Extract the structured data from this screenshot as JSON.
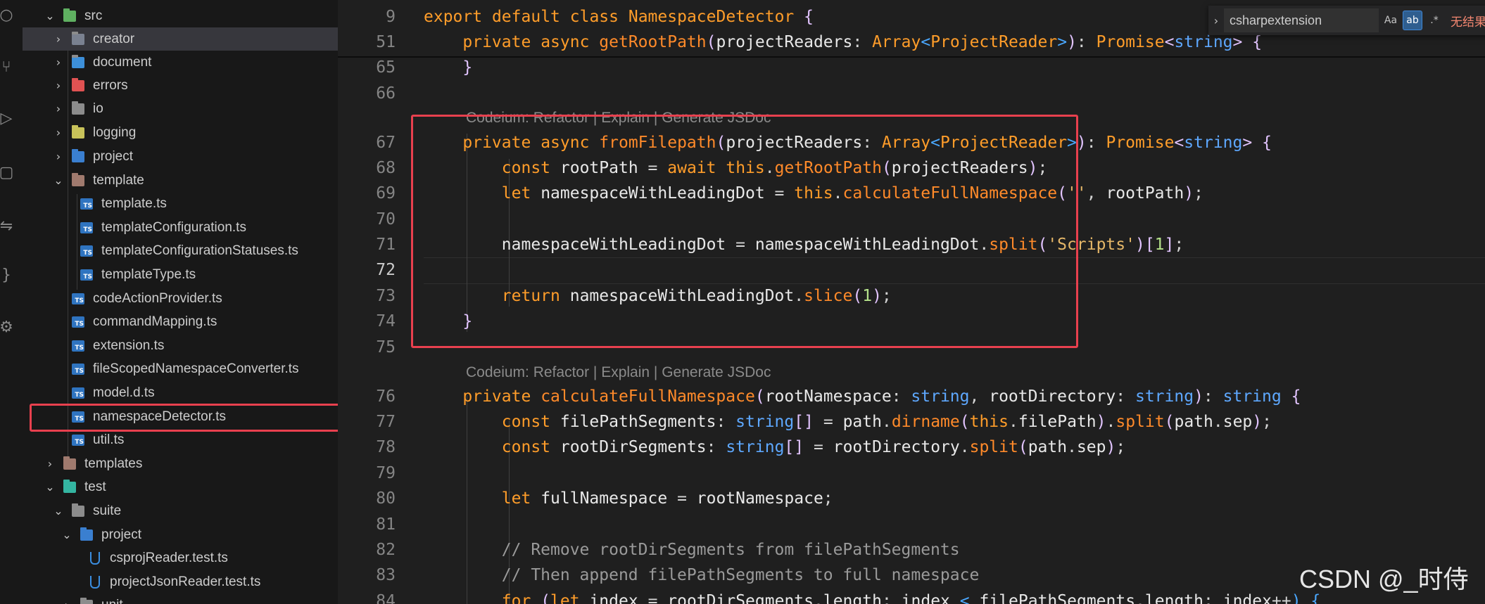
{
  "explorer": {
    "items": [
      {
        "label": "src",
        "expanded": true,
        "icon": "folder-src"
      },
      {
        "label": "creator",
        "expanded": false,
        "icon": "folder"
      },
      {
        "label": "document",
        "expanded": false,
        "icon": "folder-document"
      },
      {
        "label": "errors",
        "expanded": false,
        "icon": "folder-errors"
      },
      {
        "label": "io",
        "expanded": false,
        "icon": "folder"
      },
      {
        "label": "logging",
        "expanded": false,
        "icon": "folder-logging"
      },
      {
        "label": "project",
        "expanded": false,
        "icon": "folder-project"
      },
      {
        "label": "template",
        "expanded": true,
        "icon": "folder-template"
      },
      {
        "label": "template.ts",
        "icon": "typescript-file"
      },
      {
        "label": "templateConfiguration.ts",
        "icon": "typescript-file"
      },
      {
        "label": "templateConfigurationStatuses.ts",
        "icon": "typescript-file"
      },
      {
        "label": "templateType.ts",
        "icon": "typescript-file"
      },
      {
        "label": "codeActionProvider.ts",
        "icon": "typescript-file"
      },
      {
        "label": "commandMapping.ts",
        "icon": "typescript-file"
      },
      {
        "label": "extension.ts",
        "icon": "typescript-file"
      },
      {
        "label": "fileScopedNamespaceConverter.ts",
        "icon": "typescript-file"
      },
      {
        "label": "model.d.ts",
        "icon": "typescript-file"
      },
      {
        "label": "namespaceDetector.ts",
        "icon": "typescript-file"
      },
      {
        "label": "util.ts",
        "icon": "typescript-file"
      },
      {
        "label": "templates",
        "expanded": false,
        "icon": "folder-template"
      },
      {
        "label": "test",
        "expanded": true,
        "icon": "folder-test"
      },
      {
        "label": "suite",
        "expanded": true,
        "icon": "folder"
      },
      {
        "label": "project",
        "expanded": true,
        "icon": "folder-project"
      },
      {
        "label": "csprojReader.test.ts",
        "icon": "test-file"
      },
      {
        "label": "projectJsonReader.test.ts",
        "icon": "test-file"
      },
      {
        "label": "unit",
        "expanded": false,
        "icon": "folder"
      }
    ]
  },
  "find_widget": {
    "query": "csharpextension",
    "match_case": "Aa",
    "whole_word": "ab",
    "regex": ".*",
    "results": "无结果"
  },
  "editor": {
    "codelens_1": "Codeium: Refactor | Explain | Generate JSDoc",
    "codelens_2": "Codeium: Refactor | Explain | Generate JSDoc",
    "lines": [
      {
        "num": "9",
        "code": "export default class NamespaceDetector {"
      },
      {
        "num": "51",
        "code": "    private async getRootPath(projectReaders: Array<ProjectReader>): Promise<string> {"
      },
      {
        "num": "65",
        "code": "    }"
      },
      {
        "num": "66",
        "code": ""
      },
      {
        "num": "67",
        "code": "    private async fromFilepath(projectReaders: Array<ProjectReader>): Promise<string> {"
      },
      {
        "num": "68",
        "code": "        const rootPath = await this.getRootPath(projectReaders);"
      },
      {
        "num": "69",
        "code": "        let namespaceWithLeadingDot = this.calculateFullNamespace('', rootPath);"
      },
      {
        "num": "70",
        "code": ""
      },
      {
        "num": "71",
        "code": "        namespaceWithLeadingDot = namespaceWithLeadingDot.split('Scripts')[1];"
      },
      {
        "num": "72",
        "code": ""
      },
      {
        "num": "73",
        "code": "        return namespaceWithLeadingDot.slice(1);"
      },
      {
        "num": "74",
        "code": "    }"
      },
      {
        "num": "75",
        "code": ""
      },
      {
        "num": "76",
        "code": "    private calculateFullNamespace(rootNamespace: string, rootDirectory: string): string {"
      },
      {
        "num": "77",
        "code": "        const filePathSegments: string[] = path.dirname(this.filePath).split(path.sep);"
      },
      {
        "num": "78",
        "code": "        const rootDirSegments: string[] = rootDirectory.split(path.sep);"
      },
      {
        "num": "79",
        "code": ""
      },
      {
        "num": "80",
        "code": "        let fullNamespace = rootNamespace;"
      },
      {
        "num": "81",
        "code": ""
      },
      {
        "num": "82",
        "code": "        // Remove rootDirSegments from filePathSegments"
      },
      {
        "num": "83",
        "code": "        // Then append filePathSegments to full namespace"
      },
      {
        "num": "84",
        "code": "        for (let index = rootDirSegments.length; index < filePathSegments.length; index++) {"
      }
    ]
  },
  "watermark": "CSDN @_时侍",
  "colors": {
    "highlight_box": "#e8404e",
    "accent": "#2f74c0"
  }
}
